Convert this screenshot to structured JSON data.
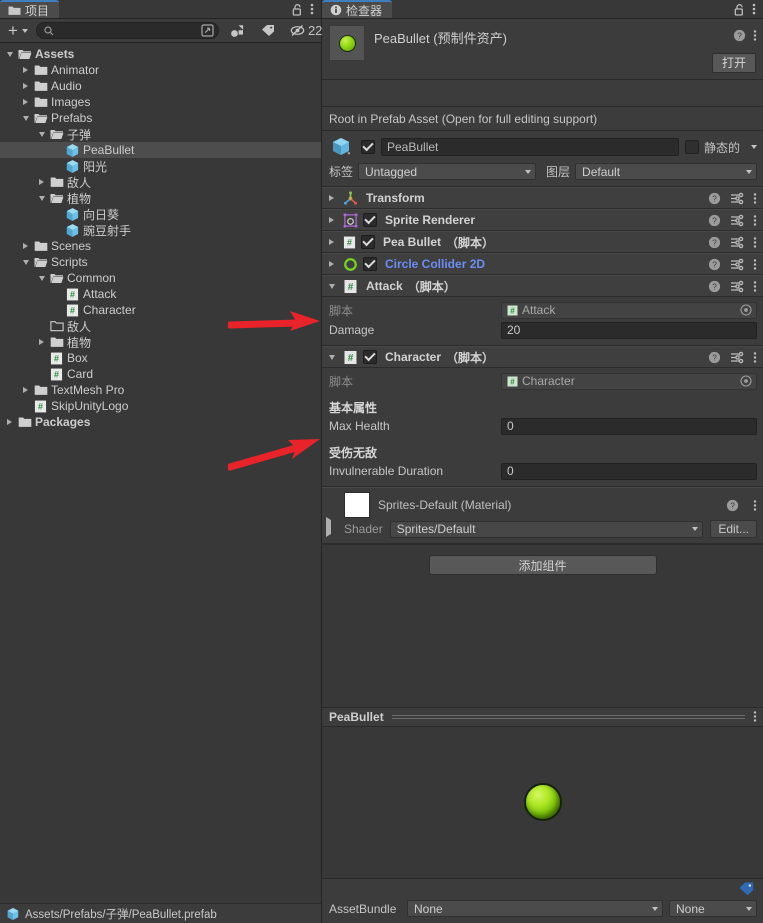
{
  "project": {
    "tab_label": "项目",
    "tab_icon": "folder-icon",
    "lock_icon": "lock-open-icon",
    "menu_icon": "kebab-menu-icon",
    "toolbar": {
      "add_label": "+",
      "search_placeholder": "",
      "search_value": "",
      "search_icon": "search-icon",
      "save_search_icon": "save-search-icon",
      "filter_type_icon": "filter-by-type-icon",
      "filter_label_icon": "filter-by-label-icon",
      "hidden_icon": "hidden-count-icon",
      "hidden_count": "22"
    },
    "tree": [
      {
        "label": "Assets",
        "depth": 0,
        "state": "expanded",
        "icon": "folder-open-icon",
        "bold": true,
        "selected": false
      },
      {
        "label": "Animator",
        "depth": 1,
        "state": "collapsed",
        "icon": "folder-icon",
        "bold": false,
        "selected": false
      },
      {
        "label": "Audio",
        "depth": 1,
        "state": "collapsed",
        "icon": "folder-icon",
        "bold": false,
        "selected": false
      },
      {
        "label": "Images",
        "depth": 1,
        "state": "collapsed",
        "icon": "folder-icon",
        "bold": false,
        "selected": false
      },
      {
        "label": "Prefabs",
        "depth": 1,
        "state": "expanded",
        "icon": "folder-open-icon",
        "bold": false,
        "selected": false
      },
      {
        "label": "子弹",
        "depth": 2,
        "state": "expanded",
        "icon": "folder-open-icon",
        "bold": false,
        "selected": false
      },
      {
        "label": "PeaBullet",
        "depth": 3,
        "state": "leaf",
        "icon": "prefab-icon",
        "bold": false,
        "selected": true
      },
      {
        "label": "阳光",
        "depth": 3,
        "state": "leaf",
        "icon": "prefab-icon",
        "bold": false,
        "selected": false
      },
      {
        "label": "敌人",
        "depth": 2,
        "state": "collapsed",
        "icon": "folder-icon",
        "bold": false,
        "selected": false
      },
      {
        "label": "植物",
        "depth": 2,
        "state": "expanded",
        "icon": "folder-open-icon",
        "bold": false,
        "selected": false
      },
      {
        "label": "向日葵",
        "depth": 3,
        "state": "leaf",
        "icon": "prefab-icon",
        "bold": false,
        "selected": false
      },
      {
        "label": "豌豆射手",
        "depth": 3,
        "state": "leaf",
        "icon": "prefab-icon",
        "bold": false,
        "selected": false
      },
      {
        "label": "Scenes",
        "depth": 1,
        "state": "collapsed",
        "icon": "folder-icon",
        "bold": false,
        "selected": false
      },
      {
        "label": "Scripts",
        "depth": 1,
        "state": "expanded",
        "icon": "folder-open-icon",
        "bold": false,
        "selected": false
      },
      {
        "label": "Common",
        "depth": 2,
        "state": "expanded",
        "icon": "folder-open-icon",
        "bold": false,
        "selected": false
      },
      {
        "label": "Attack",
        "depth": 3,
        "state": "leaf",
        "icon": "script-icon",
        "bold": false,
        "selected": false
      },
      {
        "label": "Character",
        "depth": 3,
        "state": "leaf",
        "icon": "script-icon",
        "bold": false,
        "selected": false
      },
      {
        "label": "敌人",
        "depth": 2,
        "state": "leaf",
        "icon": "folder-empty-icon",
        "bold": false,
        "selected": false
      },
      {
        "label": "植物",
        "depth": 2,
        "state": "collapsed",
        "icon": "folder-icon",
        "bold": false,
        "selected": false
      },
      {
        "label": "Box",
        "depth": 2,
        "state": "leaf",
        "icon": "script-icon",
        "bold": false,
        "selected": false
      },
      {
        "label": "Card",
        "depth": 2,
        "state": "leaf",
        "icon": "script-icon",
        "bold": false,
        "selected": false
      },
      {
        "label": "TextMesh Pro",
        "depth": 1,
        "state": "collapsed",
        "icon": "folder-icon",
        "bold": false,
        "selected": false
      },
      {
        "label": "SkipUnityLogo",
        "depth": 1,
        "state": "leaf",
        "icon": "script-icon",
        "bold": false,
        "selected": false
      },
      {
        "label": "Packages",
        "depth": 0,
        "state": "collapsed",
        "icon": "folder-icon",
        "bold": true,
        "selected": false
      }
    ],
    "status_path": "Assets/Prefabs/子弹/PeaBullet.prefab",
    "status_icon": "prefab-icon"
  },
  "inspector": {
    "tab_label": "检查器",
    "tab_icon": "info-icon",
    "lock_icon": "lock-open-icon",
    "menu_icon": "kebab-menu-icon",
    "asset_title": "PeaBullet (预制件资产)",
    "asset_thumb_icon": "pea-bullet-thumbnail",
    "help_icon": "help-icon",
    "open_button": "打开",
    "prefab_note": "Root in Prefab Asset (Open for full editing support)",
    "gameobject": {
      "icon": "prefab-cube-icon",
      "enabled": true,
      "name": "PeaBullet",
      "static_label": "静态的",
      "static_checked": false,
      "tag_label": "标签",
      "tag_value": "Untagged",
      "layer_label": "图层",
      "layer_value": "Default"
    },
    "components": [
      {
        "name": "Transform",
        "icon": "transform-icon",
        "has_checkbox": false,
        "enabled": false,
        "expanded": false,
        "suffix": "",
        "blue": false
      },
      {
        "name": "Sprite Renderer",
        "icon": "sprite-renderer-icon",
        "has_checkbox": true,
        "enabled": true,
        "expanded": false,
        "suffix": "",
        "blue": false
      },
      {
        "name": "Pea Bullet",
        "icon": "script-icon",
        "has_checkbox": true,
        "enabled": true,
        "expanded": false,
        "suffix": "（脚本）",
        "blue": false
      },
      {
        "name": "Circle Collider 2D",
        "icon": "circle-collider-2d-icon",
        "has_checkbox": true,
        "enabled": true,
        "expanded": false,
        "suffix": "",
        "blue": true
      }
    ],
    "attack": {
      "name": "Attack",
      "suffix": "（脚本）",
      "icon": "script-icon",
      "has_checkbox": false,
      "expanded": true,
      "script_label": "脚本",
      "script_value": "Attack",
      "damage_label": "Damage",
      "damage_value": "20"
    },
    "character": {
      "name": "Character",
      "suffix": "（脚本）",
      "icon": "script-icon",
      "has_checkbox": true,
      "enabled": true,
      "expanded": true,
      "script_label": "脚本",
      "script_value": "Character",
      "section1_title": "基本属性",
      "max_health_label": "Max Health",
      "max_health_value": "0",
      "section2_title": "受伤无敌",
      "invuln_label": "Invulnerable Duration",
      "invuln_value": "0"
    },
    "material": {
      "title": "Sprites-Default (Material)",
      "swatch_color": "#ffffff",
      "shader_label": "Shader",
      "shader_value": "Sprites/Default",
      "edit_button": "Edit..."
    },
    "add_component": "添加组件",
    "preview": {
      "title": "PeaBullet",
      "menu_icon": "kebab-menu-icon",
      "ball_icon": "pea-bullet-preview"
    },
    "bundle": {
      "tag_icon": "asset-label-icon",
      "label": "AssetBundle",
      "value": "None",
      "variant_value": "None"
    }
  },
  "annotations": {
    "arrow_color": "#e8232a",
    "arrows": [
      {
        "name": "arrow-attack-component"
      },
      {
        "name": "arrow-character-component"
      }
    ]
  }
}
